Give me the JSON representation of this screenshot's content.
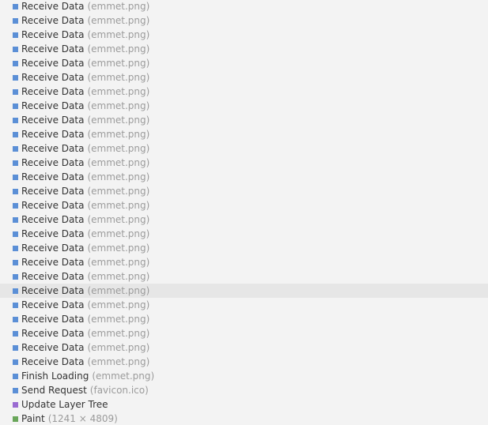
{
  "colors": {
    "loading": "#5b8fd6",
    "rendering": "#9a6bd1",
    "painting": "#69a65a"
  },
  "selected_index": 20,
  "records": [
    {
      "name": "Receive Data",
      "detail": "(emmet.png)",
      "category": "loading"
    },
    {
      "name": "Receive Data",
      "detail": "(emmet.png)",
      "category": "loading"
    },
    {
      "name": "Receive Data",
      "detail": "(emmet.png)",
      "category": "loading"
    },
    {
      "name": "Receive Data",
      "detail": "(emmet.png)",
      "category": "loading"
    },
    {
      "name": "Receive Data",
      "detail": "(emmet.png)",
      "category": "loading"
    },
    {
      "name": "Receive Data",
      "detail": "(emmet.png)",
      "category": "loading"
    },
    {
      "name": "Receive Data",
      "detail": "(emmet.png)",
      "category": "loading"
    },
    {
      "name": "Receive Data",
      "detail": "(emmet.png)",
      "category": "loading"
    },
    {
      "name": "Receive Data",
      "detail": "(emmet.png)",
      "category": "loading"
    },
    {
      "name": "Receive Data",
      "detail": "(emmet.png)",
      "category": "loading"
    },
    {
      "name": "Receive Data",
      "detail": "(emmet.png)",
      "category": "loading"
    },
    {
      "name": "Receive Data",
      "detail": "(emmet.png)",
      "category": "loading"
    },
    {
      "name": "Receive Data",
      "detail": "(emmet.png)",
      "category": "loading"
    },
    {
      "name": "Receive Data",
      "detail": "(emmet.png)",
      "category": "loading"
    },
    {
      "name": "Receive Data",
      "detail": "(emmet.png)",
      "category": "loading"
    },
    {
      "name": "Receive Data",
      "detail": "(emmet.png)",
      "category": "loading"
    },
    {
      "name": "Receive Data",
      "detail": "(emmet.png)",
      "category": "loading"
    },
    {
      "name": "Receive Data",
      "detail": "(emmet.png)",
      "category": "loading"
    },
    {
      "name": "Receive Data",
      "detail": "(emmet.png)",
      "category": "loading"
    },
    {
      "name": "Receive Data",
      "detail": "(emmet.png)",
      "category": "loading"
    },
    {
      "name": "Receive Data",
      "detail": "(emmet.png)",
      "category": "loading"
    },
    {
      "name": "Receive Data",
      "detail": "(emmet.png)",
      "category": "loading"
    },
    {
      "name": "Receive Data",
      "detail": "(emmet.png)",
      "category": "loading"
    },
    {
      "name": "Receive Data",
      "detail": "(emmet.png)",
      "category": "loading"
    },
    {
      "name": "Receive Data",
      "detail": "(emmet.png)",
      "category": "loading"
    },
    {
      "name": "Receive Data",
      "detail": "(emmet.png)",
      "category": "loading"
    },
    {
      "name": "Finish Loading",
      "detail": "(emmet.png)",
      "category": "loading"
    },
    {
      "name": "Send Request",
      "detail": "(favicon.ico)",
      "category": "loading"
    },
    {
      "name": "Update Layer Tree",
      "detail": "",
      "category": "rendering"
    },
    {
      "name": "Paint",
      "detail": "(1241 × 4809)",
      "category": "painting"
    }
  ]
}
